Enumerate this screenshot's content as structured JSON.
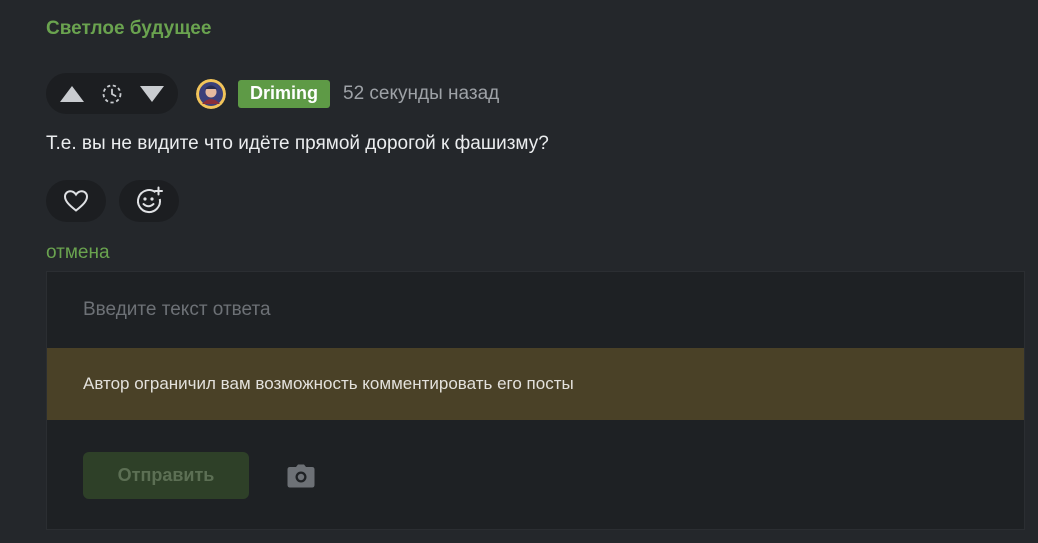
{
  "parent": {
    "title": "Светлое будущее"
  },
  "comment": {
    "author": "Driming",
    "time_ago": "52 секунды назад",
    "text": "Т.е. вы не видите что идёте прямой дорогой к фашизму?"
  },
  "icons": {
    "upvote": "triangle-up-icon",
    "rating_pending": "clock-dashed-icon",
    "downvote": "triangle-down-icon",
    "like": "heart-icon",
    "emoji": "smiley-add-icon",
    "attach_image": "camera-icon"
  },
  "reply": {
    "cancel_label": "отмена",
    "placeholder": "Введите текст ответа",
    "restriction_notice": "Автор ограничил вам возможность комментировать его посты",
    "submit_label": "Отправить"
  },
  "colors": {
    "background": "#24272b",
    "accent_green": "#6aa34f",
    "author_badge": "#5e9a46",
    "restriction_bg": "#4a4127",
    "submit_disabled_bg": "#2e4028"
  }
}
